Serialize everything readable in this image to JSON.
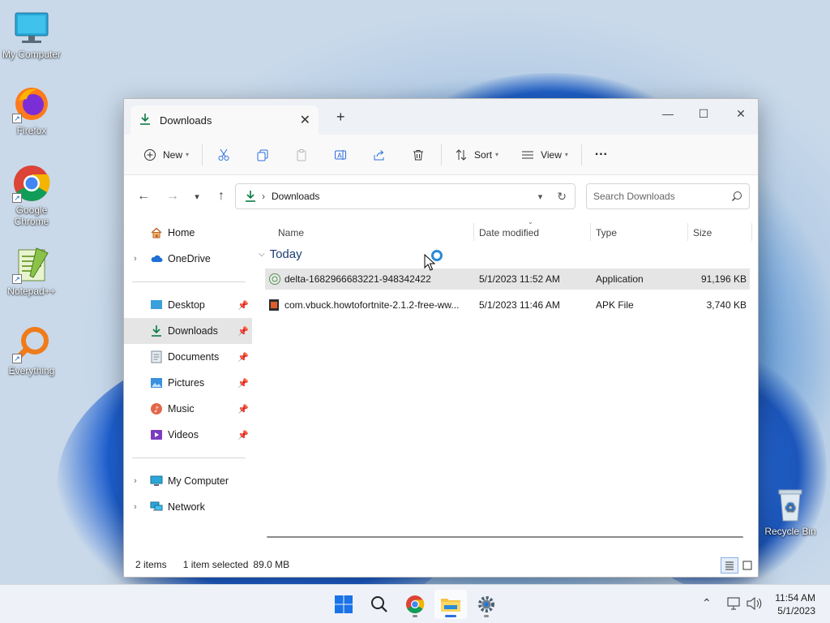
{
  "desktop": {
    "icons": [
      {
        "label": "My Computer"
      },
      {
        "label": "Firefox"
      },
      {
        "label": "Google Chrome"
      },
      {
        "label": "Notepad++"
      },
      {
        "label": "Everything"
      },
      {
        "label": "Recycle Bin"
      }
    ]
  },
  "window": {
    "tab_title": "Downloads",
    "new_tab": "+",
    "toolbar": {
      "new_label": "New",
      "sort_label": "Sort",
      "view_label": "View",
      "more_label": "···"
    },
    "address": {
      "crumb": "Downloads"
    },
    "search": {
      "placeholder": "Search Downloads"
    },
    "sidebar": {
      "top": [
        {
          "label": "Home"
        },
        {
          "label": "OneDrive"
        }
      ],
      "pinned": [
        {
          "label": "Desktop"
        },
        {
          "label": "Downloads"
        },
        {
          "label": "Documents"
        },
        {
          "label": "Pictures"
        },
        {
          "label": "Music"
        },
        {
          "label": "Videos"
        }
      ],
      "bottom": [
        {
          "label": "My Computer"
        },
        {
          "label": "Network"
        }
      ]
    },
    "columns": {
      "name": "Name",
      "date": "Date modified",
      "type": "Type",
      "size": "Size"
    },
    "group_label": "Today",
    "files": [
      {
        "name": "delta-1682966683221-948342422",
        "date": "5/1/2023 11:52 AM",
        "type": "Application",
        "size": "91,196 KB"
      },
      {
        "name": "com.vbuck.howtofortnite-2.1.2-free-ww...",
        "date": "5/1/2023 11:46 AM",
        "type": "APK File",
        "size": "3,740 KB"
      }
    ],
    "status": {
      "items": "2 items",
      "selected": "1 item selected",
      "size": "89.0 MB"
    }
  },
  "taskbar": {
    "time": "11:54 AM",
    "date": "5/1/2023"
  },
  "colors": {
    "accent": "#0b7a45",
    "selection": "#e5e5e5",
    "taskbar_active": "#2a6fdc"
  }
}
